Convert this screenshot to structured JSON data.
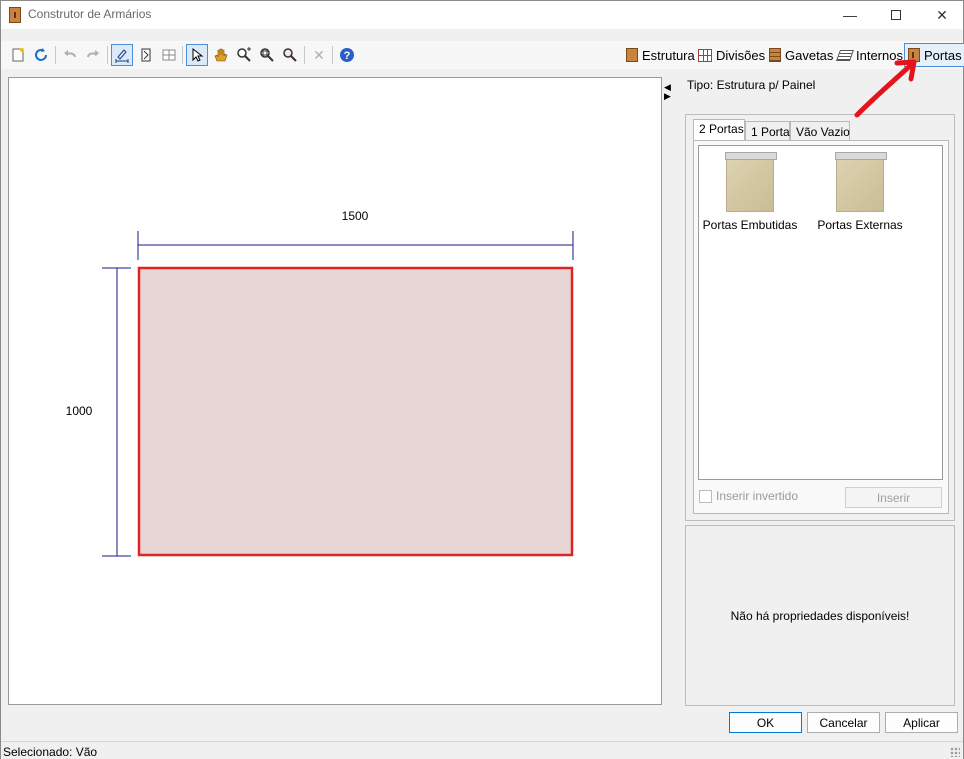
{
  "window": {
    "title": "Construtor de Armários"
  },
  "toolbar": {
    "modules": [
      {
        "label": "Estrutura",
        "icon": "cabinet-icon"
      },
      {
        "label": "Divisões",
        "icon": "grid-icon"
      },
      {
        "label": "Gavetas",
        "icon": "drawer-icon"
      },
      {
        "label": "Internos",
        "icon": "shelves-icon"
      },
      {
        "label": "Portas",
        "icon": "door-icon",
        "active": true
      }
    ]
  },
  "drawing": {
    "width_label": "1500",
    "height_label": "1000",
    "fill_color": "#e8d5d6",
    "outline_color": "#e02424",
    "dimension_color": "#1a1a8a"
  },
  "panel": {
    "tipo": "Tipo: Estrutura p/ Painel",
    "tabs": [
      "2 Portas",
      "1 Porta",
      "Vão Vazio"
    ],
    "selected_tab": "2 Portas",
    "items": [
      {
        "label": "Portas Embutidas"
      },
      {
        "label": "Portas Externas"
      }
    ],
    "checkbox_label": "Inserir invertido",
    "insert_button": "Inserir",
    "properties_message": "Não há propriedades disponíveis!"
  },
  "dialog_buttons": {
    "ok": "OK",
    "cancel": "Cancelar",
    "apply": "Aplicar"
  },
  "status": {
    "text": "Selecionado: Vão"
  },
  "annotation_color": "#e3141c"
}
